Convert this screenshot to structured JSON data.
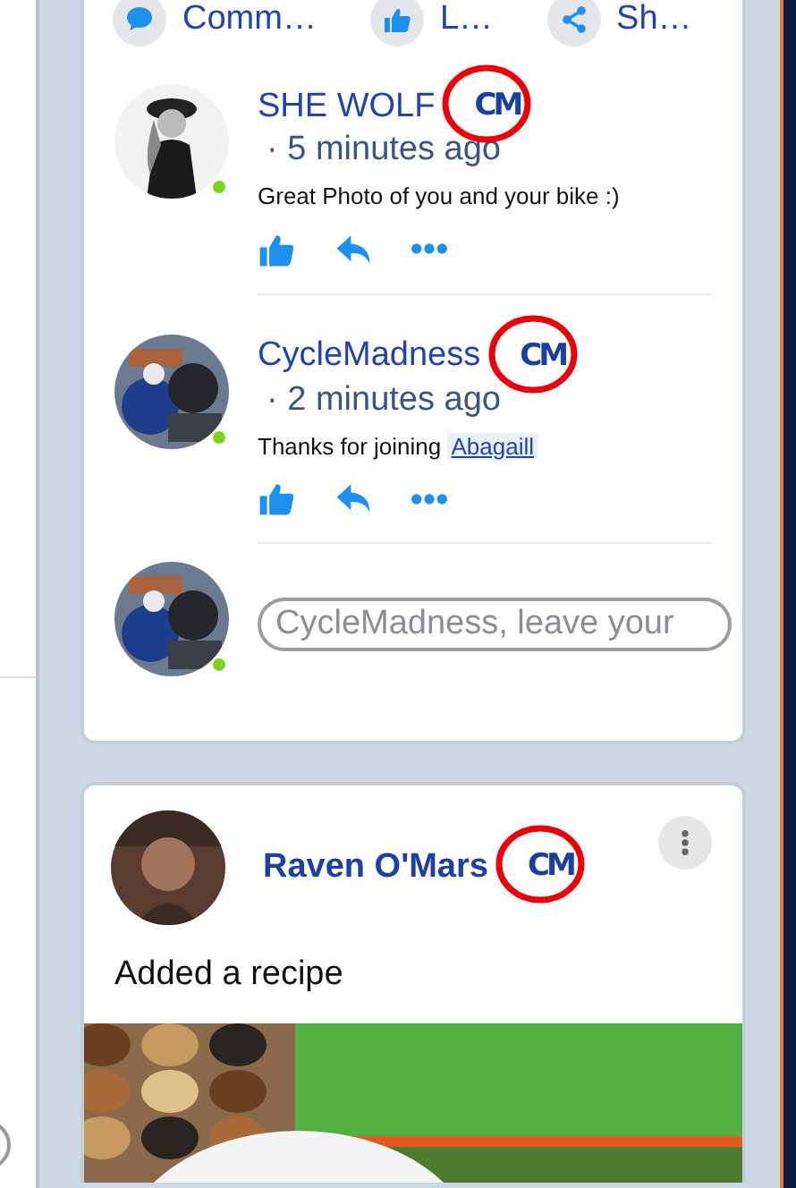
{
  "post_actions": [
    {
      "kind": "comment",
      "label": "Comm…"
    },
    {
      "kind": "like",
      "label": "L…"
    },
    {
      "kind": "share",
      "label": "Sh…"
    }
  ],
  "comments": [
    {
      "author": "SHE WOLF",
      "badge": "CM",
      "circled": true,
      "online": true,
      "time": "· 5 minutes ago",
      "text": "Great Photo of you and your bike :)"
    },
    {
      "author": "CycleMadness",
      "badge": "CM",
      "circled": true,
      "online": true,
      "time": "· 2 minutes ago",
      "text": "Thanks for joining",
      "mention": "Abagaill"
    }
  ],
  "comment_box": {
    "online": true,
    "placeholder": "CycleMadness, leave your"
  },
  "post": {
    "author": "Raven O'Mars",
    "badge": "CM",
    "circled": true,
    "text": "Added a recipe"
  }
}
